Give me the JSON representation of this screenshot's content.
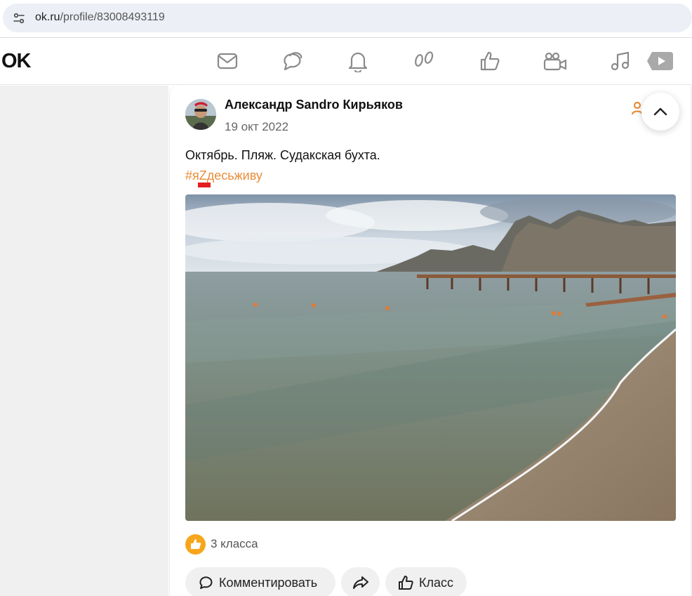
{
  "browser": {
    "url_host": "ok.ru",
    "url_path": "/profile/83008493119"
  },
  "header": {
    "logo": "OK",
    "nav_icons": [
      "mail-icon",
      "chat-icon",
      "bell-icon",
      "footprints-icon",
      "thumbs-up-icon",
      "video-camera-icon",
      "music-icon",
      "video-play-icon"
    ]
  },
  "post": {
    "author": "Александр Sandro Кирьяков",
    "date": "19 окт 2022",
    "text": "Октябрь. Пляж. Судакская бухта.",
    "hashtag": "#яZдесьживу",
    "likes_text": "3 класса",
    "actions": {
      "comment": "Комментировать",
      "like": "Класс"
    }
  },
  "colors": {
    "accent": "#e98d3a",
    "like_badge": "#f7a51c",
    "flag": "#e21e1e"
  }
}
